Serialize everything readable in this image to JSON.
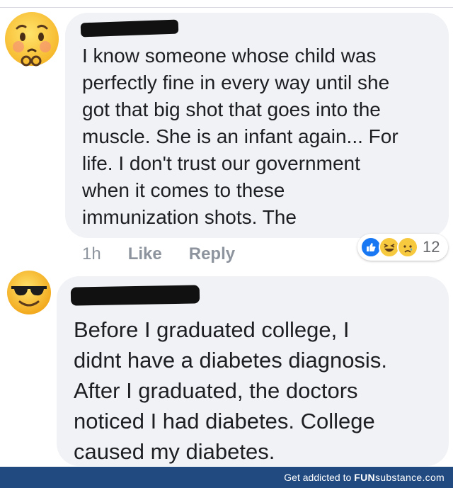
{
  "comments": [
    {
      "text_lines": [
        "I know someone whose child was",
        "perfectly fine in every way until she",
        "got that big shot that goes into the",
        "muscle. She is  an infant again... For",
        "life. I don't trust our government",
        "when it comes to these",
        "immunization shots. The"
      ],
      "avatar_icon": "worried-face-emoji-icon",
      "time": "1h",
      "like_label": "Like",
      "reply_label": "Reply",
      "reaction_count": "12",
      "reaction_icons": [
        "like-reaction-icon",
        "haha-reaction-icon",
        "sad-reaction-icon"
      ]
    },
    {
      "text_lines": [
        "Before I graduated college, I",
        "didnt have a diabetes diagnosis.",
        "After I graduated, the doctors",
        "noticed I had diabetes. College",
        "caused my diabetes."
      ],
      "avatar_icon": "sunglasses-face-emoji-icon"
    }
  ],
  "footer": {
    "prefix": "Get addicted to",
    "brand_bold": "FUN",
    "brand_rest": "substance.com"
  },
  "colors": {
    "bubble": "#f0f2f5",
    "footer": "#214a80",
    "like_blue": "#1877f2"
  }
}
